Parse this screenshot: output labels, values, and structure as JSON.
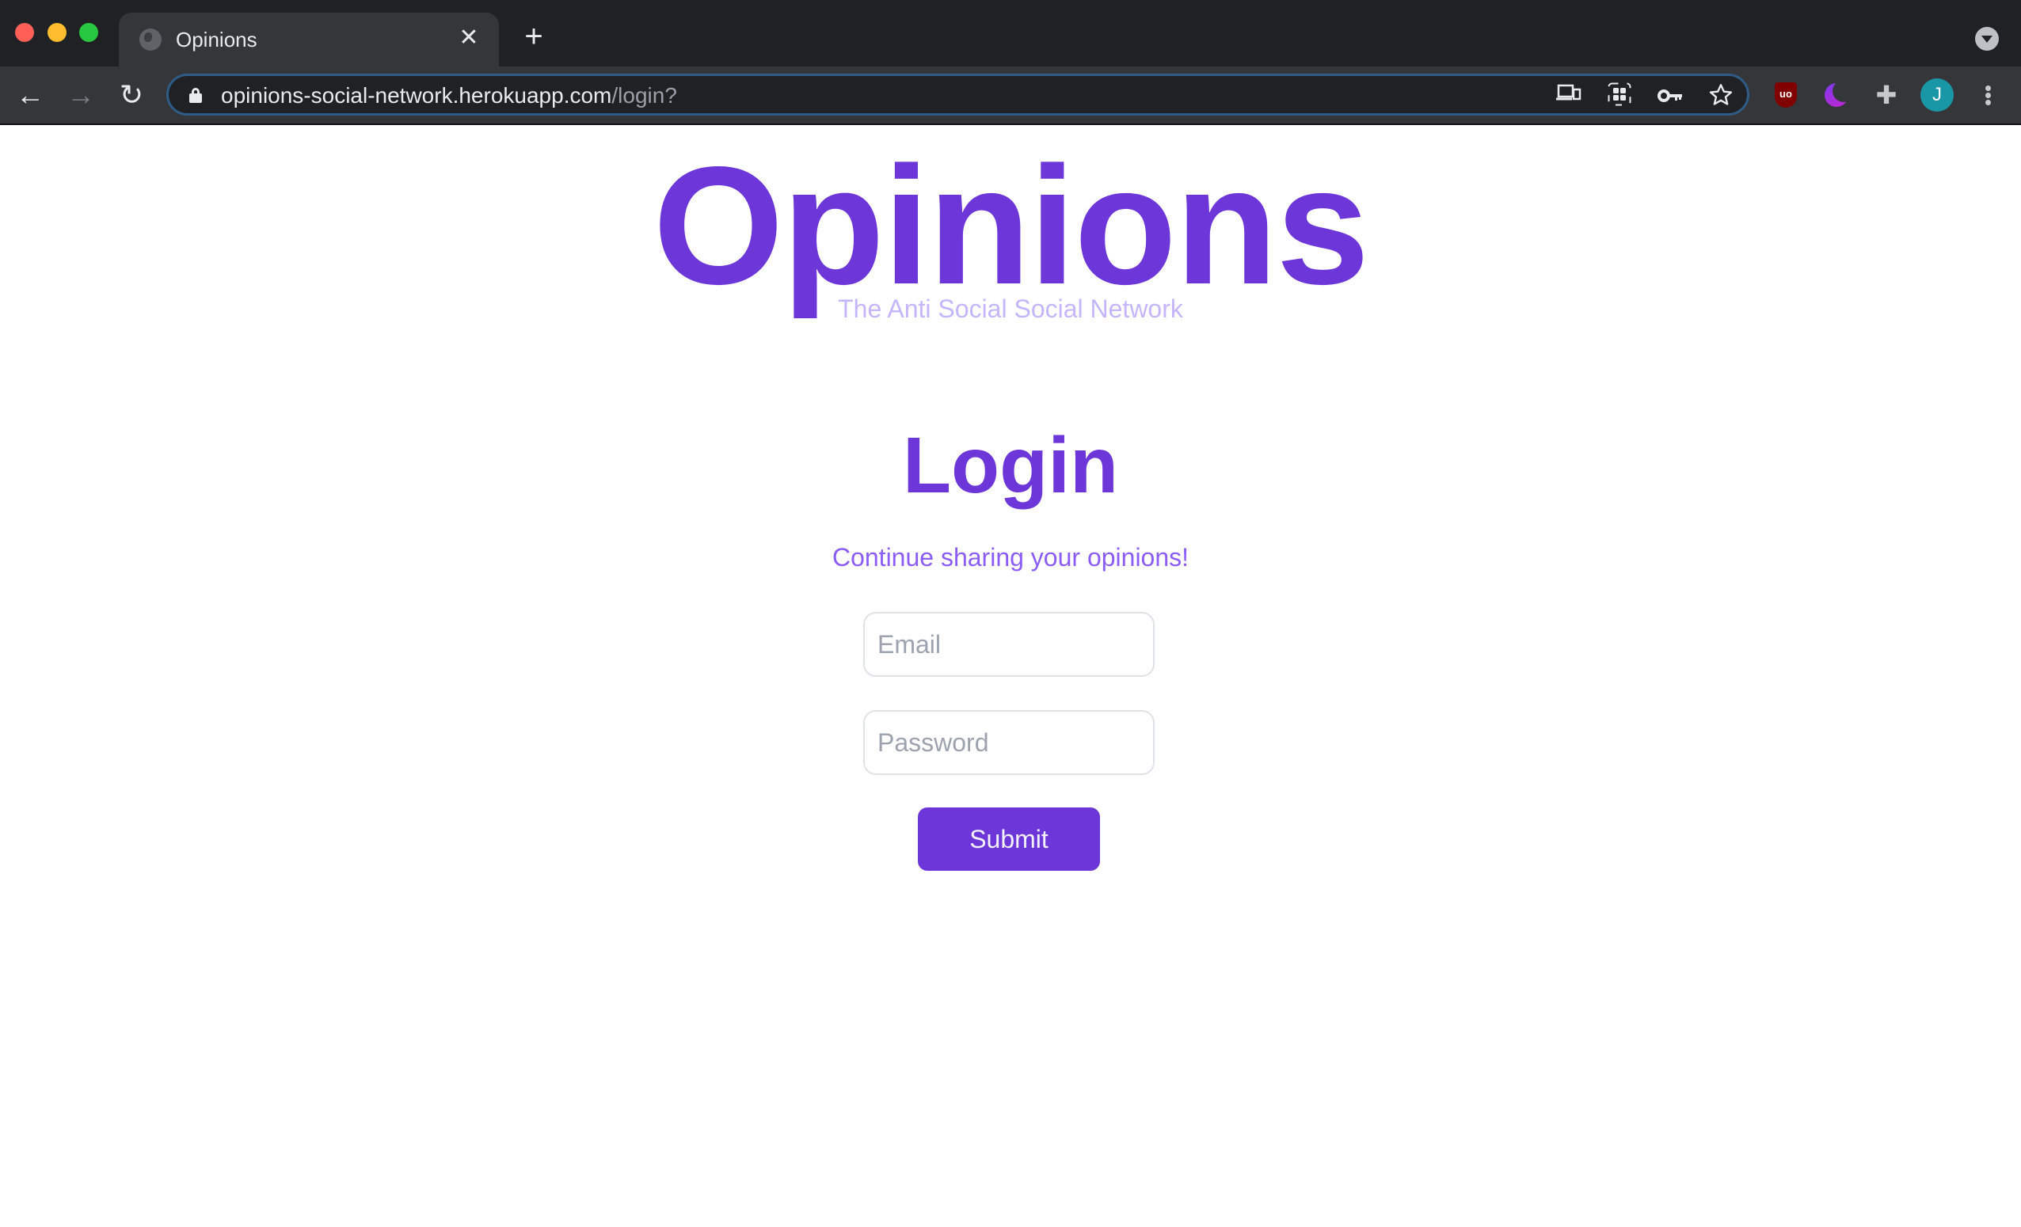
{
  "browser": {
    "tab": {
      "title": "Opinions",
      "favicon": "globe-icon",
      "close_glyph": "✕"
    },
    "new_tab_glyph": "+",
    "nav": {
      "back": "←",
      "forward": "→",
      "reload": "↻"
    },
    "address": {
      "host": "opinions-social-network.herokuapp.com",
      "path": "/login?"
    },
    "omnibox_icons": [
      "cast-devices-icon",
      "qr-code-icon",
      "password-key-icon",
      "bookmark-star-icon"
    ],
    "extensions": [
      {
        "name": "ublock-origin",
        "label": "uo"
      },
      {
        "name": "dark-mode-moon"
      },
      {
        "name": "extensions-puzzle",
        "glyph": "✚"
      }
    ],
    "profile_initial": "J",
    "colors": {
      "accent_focus": "#2f5c86",
      "avatar": "#1a97a7"
    }
  },
  "page": {
    "brand": {
      "title": "Opinions",
      "subtitle": "The Anti Social Social Network"
    },
    "login": {
      "title": "Login",
      "subtitle": "Continue sharing your opinions!",
      "email": {
        "value": "",
        "placeholder": "Email"
      },
      "password": {
        "value": "",
        "placeholder": "Password"
      },
      "submit_label": "Submit"
    },
    "colors": {
      "primary": "#6d36d9",
      "subtitle": "#c4b5fd",
      "tagline": "#8b5cf6",
      "placeholder": "#9ca3af"
    }
  }
}
